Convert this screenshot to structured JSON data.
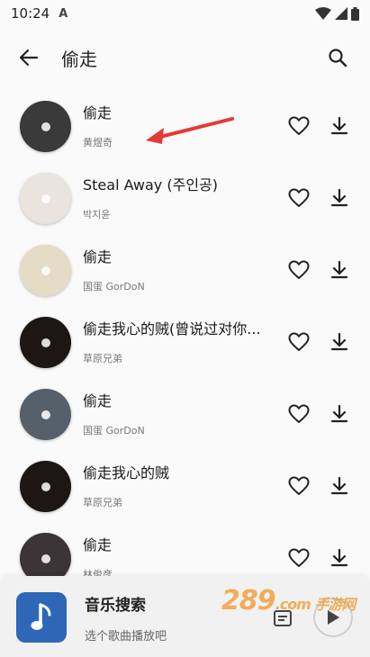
{
  "status": {
    "time": "10:24",
    "indicator": "A"
  },
  "header": {
    "title": "偷走"
  },
  "songs": [
    {
      "title": "偷走",
      "artist": "黄煜奇",
      "cover_color": "#3a3a3a"
    },
    {
      "title": "Steal Away (주인공)",
      "artist": "박지윤",
      "cover_color": "#e9e4de"
    },
    {
      "title": "偷走",
      "artist": "国蛋 GorDoN",
      "cover_color": "#e5dcc6"
    },
    {
      "title": "偷走我心的贼(曾说过对你...",
      "artist": "草原兄弟",
      "cover_color": "#1d1612"
    },
    {
      "title": "偷走",
      "artist": "国蛋 GorDoN",
      "cover_color": "#55606a"
    },
    {
      "title": "偷走我心的贼",
      "artist": "草原兄弟",
      "cover_color": "#1d1612"
    },
    {
      "title": "偷走",
      "artist": "林俊彦",
      "cover_color": "#3c3436"
    }
  ],
  "player": {
    "title": "音乐搜索",
    "subtitle": "选个歌曲播放吧"
  },
  "watermark": {
    "main": "289",
    "sub": ".com 手游网"
  },
  "colors": {
    "accent_red": "#e53935",
    "player_art_blue": "#2f67b7"
  }
}
